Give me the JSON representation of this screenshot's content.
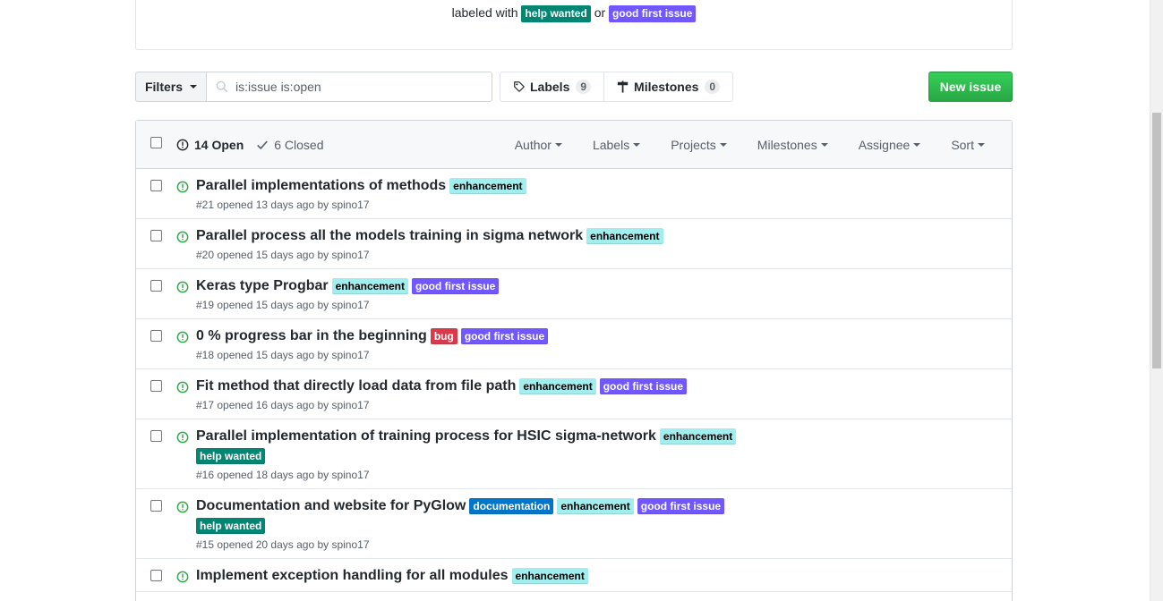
{
  "banner": {
    "prefix": "labeled with",
    "connector": "or",
    "labels": [
      {
        "text": "help wanted",
        "bg": "#008672",
        "fg": "#ffffff"
      },
      {
        "text": "good first issue",
        "bg": "#7057ff",
        "fg": "#ffffff"
      }
    ]
  },
  "toolbar": {
    "filters_label": "Filters",
    "search_value": "is:issue is:open",
    "labels_label": "Labels",
    "labels_count": "9",
    "milestones_label": "Milestones",
    "milestones_count": "0",
    "new_issue_label": "New issue"
  },
  "header": {
    "open_label": "14 Open",
    "closed_label": "6 Closed",
    "filters": [
      "Author",
      "Labels",
      "Projects",
      "Milestones",
      "Assignee",
      "Sort"
    ]
  },
  "label_styles": {
    "enhancement": {
      "bg": "#a2eeef",
      "fg": "#000000"
    },
    "good first issue": {
      "bg": "#7057ff",
      "fg": "#ffffff"
    },
    "bug": {
      "bg": "#d73a4a",
      "fg": "#ffffff"
    },
    "help wanted": {
      "bg": "#008672",
      "fg": "#ffffff"
    },
    "documentation": {
      "bg": "#0075ca",
      "fg": "#ffffff"
    }
  },
  "issues": [
    {
      "title": "Parallel implementations of methods",
      "labels": [
        "enhancement"
      ],
      "meta": "#21 opened 13 days ago by spino17"
    },
    {
      "title": "Parallel process all the models training in sigma network",
      "labels": [
        "enhancement"
      ],
      "meta": "#20 opened 15 days ago by spino17"
    },
    {
      "title": "Keras type Progbar",
      "labels": [
        "enhancement",
        "good first issue"
      ],
      "meta": "#19 opened 15 days ago by spino17"
    },
    {
      "title": "0 % progress bar in the beginning",
      "labels": [
        "bug",
        "good first issue"
      ],
      "meta": "#18 opened 15 days ago by spino17"
    },
    {
      "title": "Fit method that directly load data from file path",
      "labels": [
        "enhancement",
        "good first issue"
      ],
      "meta": "#17 opened 16 days ago by spino17"
    },
    {
      "title": "Parallel implementation of training process for HSIC sigma-network",
      "labels": [
        "enhancement",
        "help wanted"
      ],
      "meta": "#16 opened 18 days ago by spino17"
    },
    {
      "title": "Documentation and website for PyGlow",
      "labels": [
        "documentation",
        "enhancement",
        "good first issue",
        "help wanted"
      ],
      "meta": "#15 opened 20 days ago by spino17"
    },
    {
      "title": "Implement exception handling for all modules",
      "labels": [
        "enhancement"
      ],
      "meta": ""
    }
  ],
  "colors": {
    "primary_green": "#28a745",
    "open_icon": "#28a745",
    "border": "#d1d5da"
  }
}
